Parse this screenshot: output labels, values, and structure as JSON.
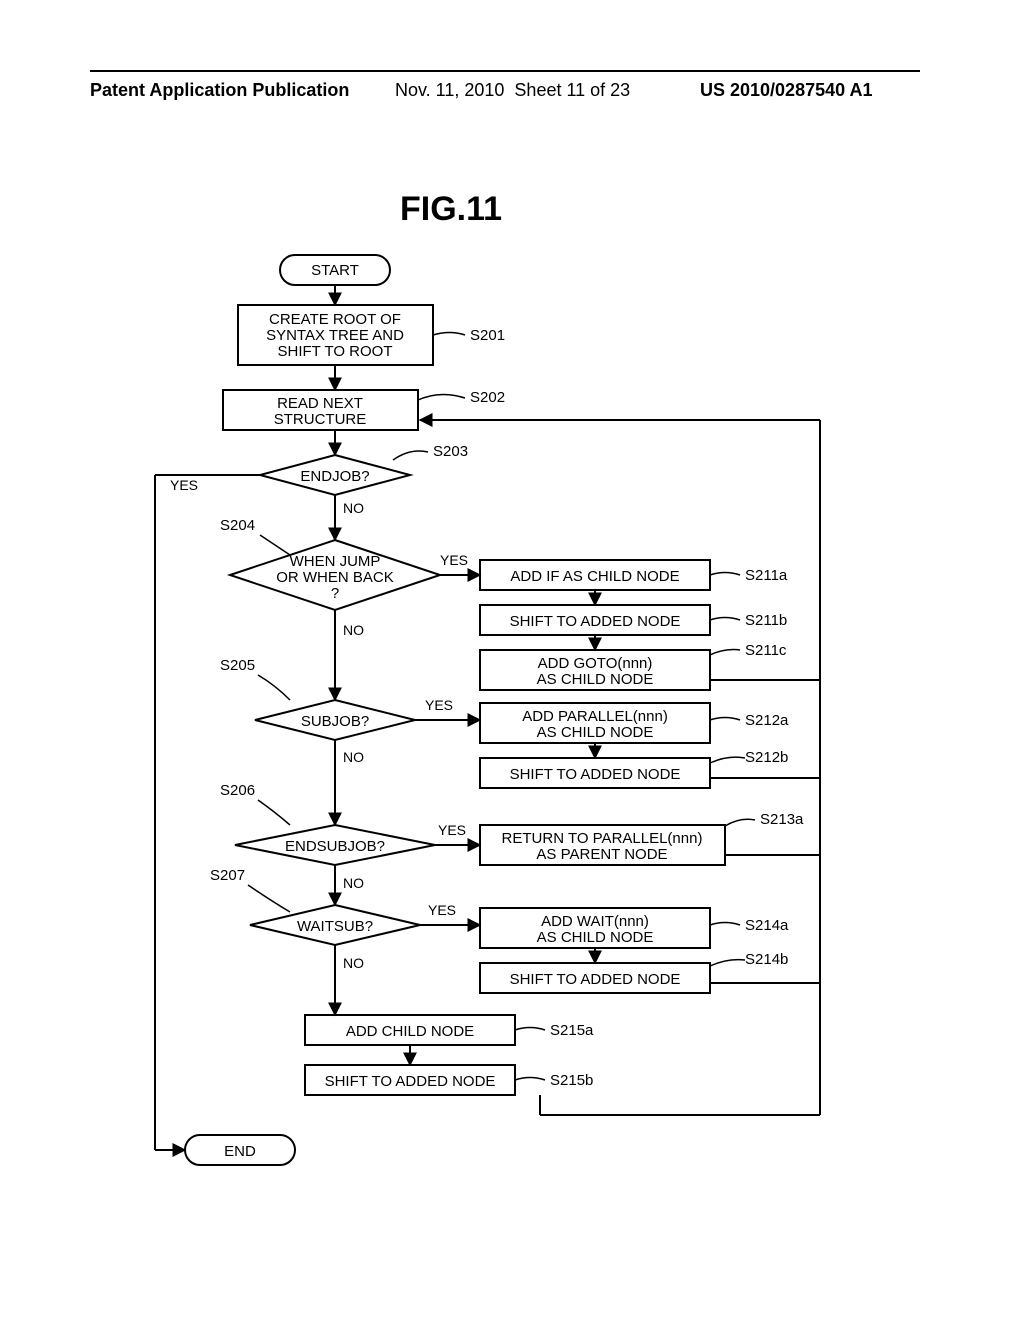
{
  "header": {
    "left": "Patent Application Publication",
    "date": "Nov. 11, 2010",
    "sheet": "Sheet 11 of 23",
    "pubno": "US 2010/0287540 A1"
  },
  "figure_title": "FIG.11",
  "nodes": {
    "start": "START",
    "end": "END",
    "s201": "CREATE ROOT OF\nSYNTAX TREE AND\nSHIFT TO ROOT",
    "s202": "READ NEXT\nSTRUCTURE",
    "s203": "ENDJOB?",
    "s204": "WHEN JUMP\nOR WHEN BACK\n?",
    "s205": "SUBJOB?",
    "s206": "ENDSUBJOB?",
    "s207": "WAITSUB?",
    "s211a": "ADD IF AS CHILD NODE",
    "s211b": "SHIFT TO ADDED NODE",
    "s211c": "ADD GOTO(nnn)\nAS CHILD NODE",
    "s212a": "ADD PARALLEL(nnn)\nAS CHILD NODE",
    "s212b": "SHIFT TO ADDED NODE",
    "s213a": "RETURN TO PARALLEL(nnn)\nAS PARENT NODE",
    "s214a": "ADD WAIT(nnn)\nAS CHILD NODE",
    "s214b": "SHIFT TO ADDED NODE",
    "s215a": "ADD CHILD NODE",
    "s215b": "SHIFT TO ADDED NODE"
  },
  "step_labels": {
    "s201": "S201",
    "s202": "S202",
    "s203": "S203",
    "s204": "S204",
    "s205": "S205",
    "s206": "S206",
    "s207": "S207",
    "s211a": "S211a",
    "s211b": "S211b",
    "s211c": "S211c",
    "s212a": "S212a",
    "s212b": "S212b",
    "s213a": "S213a",
    "s214a": "S214a",
    "s214b": "S214b",
    "s215a": "S215a",
    "s215b": "S215b"
  },
  "branch": {
    "yes": "YES",
    "no": "NO"
  }
}
